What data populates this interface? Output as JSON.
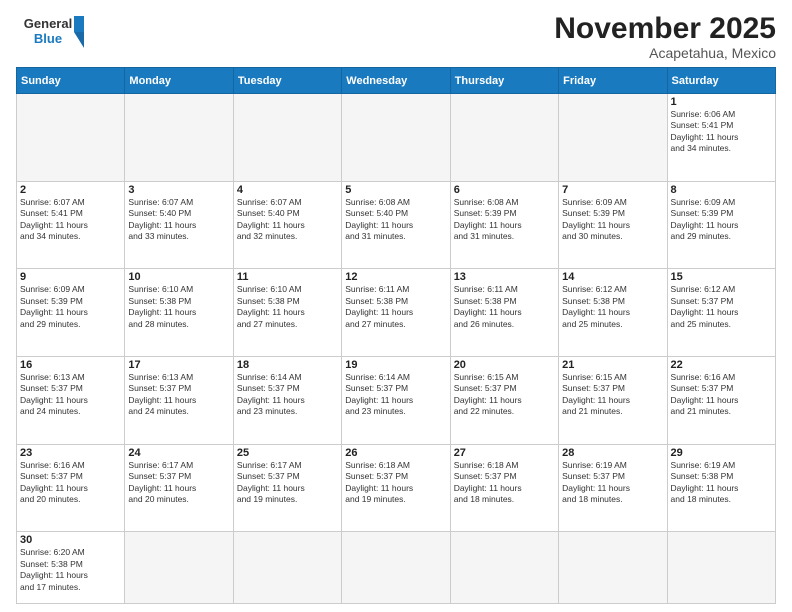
{
  "header": {
    "logo_general": "General",
    "logo_blue": "Blue",
    "month_title": "November 2025",
    "location": "Acapetahua, Mexico"
  },
  "weekdays": [
    "Sunday",
    "Monday",
    "Tuesday",
    "Wednesday",
    "Thursday",
    "Friday",
    "Saturday"
  ],
  "weeks": [
    [
      {
        "num": "",
        "info": ""
      },
      {
        "num": "",
        "info": ""
      },
      {
        "num": "",
        "info": ""
      },
      {
        "num": "",
        "info": ""
      },
      {
        "num": "",
        "info": ""
      },
      {
        "num": "",
        "info": ""
      },
      {
        "num": "1",
        "info": "Sunrise: 6:06 AM\nSunset: 5:41 PM\nDaylight: 11 hours\nand 34 minutes."
      }
    ],
    [
      {
        "num": "2",
        "info": "Sunrise: 6:07 AM\nSunset: 5:41 PM\nDaylight: 11 hours\nand 34 minutes."
      },
      {
        "num": "3",
        "info": "Sunrise: 6:07 AM\nSunset: 5:40 PM\nDaylight: 11 hours\nand 33 minutes."
      },
      {
        "num": "4",
        "info": "Sunrise: 6:07 AM\nSunset: 5:40 PM\nDaylight: 11 hours\nand 32 minutes."
      },
      {
        "num": "5",
        "info": "Sunrise: 6:08 AM\nSunset: 5:40 PM\nDaylight: 11 hours\nand 31 minutes."
      },
      {
        "num": "6",
        "info": "Sunrise: 6:08 AM\nSunset: 5:39 PM\nDaylight: 11 hours\nand 31 minutes."
      },
      {
        "num": "7",
        "info": "Sunrise: 6:09 AM\nSunset: 5:39 PM\nDaylight: 11 hours\nand 30 minutes."
      },
      {
        "num": "8",
        "info": "Sunrise: 6:09 AM\nSunset: 5:39 PM\nDaylight: 11 hours\nand 29 minutes."
      }
    ],
    [
      {
        "num": "9",
        "info": "Sunrise: 6:09 AM\nSunset: 5:39 PM\nDaylight: 11 hours\nand 29 minutes."
      },
      {
        "num": "10",
        "info": "Sunrise: 6:10 AM\nSunset: 5:38 PM\nDaylight: 11 hours\nand 28 minutes."
      },
      {
        "num": "11",
        "info": "Sunrise: 6:10 AM\nSunset: 5:38 PM\nDaylight: 11 hours\nand 27 minutes."
      },
      {
        "num": "12",
        "info": "Sunrise: 6:11 AM\nSunset: 5:38 PM\nDaylight: 11 hours\nand 27 minutes."
      },
      {
        "num": "13",
        "info": "Sunrise: 6:11 AM\nSunset: 5:38 PM\nDaylight: 11 hours\nand 26 minutes."
      },
      {
        "num": "14",
        "info": "Sunrise: 6:12 AM\nSunset: 5:38 PM\nDaylight: 11 hours\nand 25 minutes."
      },
      {
        "num": "15",
        "info": "Sunrise: 6:12 AM\nSunset: 5:37 PM\nDaylight: 11 hours\nand 25 minutes."
      }
    ],
    [
      {
        "num": "16",
        "info": "Sunrise: 6:13 AM\nSunset: 5:37 PM\nDaylight: 11 hours\nand 24 minutes."
      },
      {
        "num": "17",
        "info": "Sunrise: 6:13 AM\nSunset: 5:37 PM\nDaylight: 11 hours\nand 24 minutes."
      },
      {
        "num": "18",
        "info": "Sunrise: 6:14 AM\nSunset: 5:37 PM\nDaylight: 11 hours\nand 23 minutes."
      },
      {
        "num": "19",
        "info": "Sunrise: 6:14 AM\nSunset: 5:37 PM\nDaylight: 11 hours\nand 23 minutes."
      },
      {
        "num": "20",
        "info": "Sunrise: 6:15 AM\nSunset: 5:37 PM\nDaylight: 11 hours\nand 22 minutes."
      },
      {
        "num": "21",
        "info": "Sunrise: 6:15 AM\nSunset: 5:37 PM\nDaylight: 11 hours\nand 21 minutes."
      },
      {
        "num": "22",
        "info": "Sunrise: 6:16 AM\nSunset: 5:37 PM\nDaylight: 11 hours\nand 21 minutes."
      }
    ],
    [
      {
        "num": "23",
        "info": "Sunrise: 6:16 AM\nSunset: 5:37 PM\nDaylight: 11 hours\nand 20 minutes."
      },
      {
        "num": "24",
        "info": "Sunrise: 6:17 AM\nSunset: 5:37 PM\nDaylight: 11 hours\nand 20 minutes."
      },
      {
        "num": "25",
        "info": "Sunrise: 6:17 AM\nSunset: 5:37 PM\nDaylight: 11 hours\nand 19 minutes."
      },
      {
        "num": "26",
        "info": "Sunrise: 6:18 AM\nSunset: 5:37 PM\nDaylight: 11 hours\nand 19 minutes."
      },
      {
        "num": "27",
        "info": "Sunrise: 6:18 AM\nSunset: 5:37 PM\nDaylight: 11 hours\nand 18 minutes."
      },
      {
        "num": "28",
        "info": "Sunrise: 6:19 AM\nSunset: 5:37 PM\nDaylight: 11 hours\nand 18 minutes."
      },
      {
        "num": "29",
        "info": "Sunrise: 6:19 AM\nSunset: 5:38 PM\nDaylight: 11 hours\nand 18 minutes."
      }
    ],
    [
      {
        "num": "30",
        "info": "Sunrise: 6:20 AM\nSunset: 5:38 PM\nDaylight: 11 hours\nand 17 minutes."
      },
      {
        "num": "",
        "info": ""
      },
      {
        "num": "",
        "info": ""
      },
      {
        "num": "",
        "info": ""
      },
      {
        "num": "",
        "info": ""
      },
      {
        "num": "",
        "info": ""
      },
      {
        "num": "",
        "info": ""
      }
    ]
  ]
}
